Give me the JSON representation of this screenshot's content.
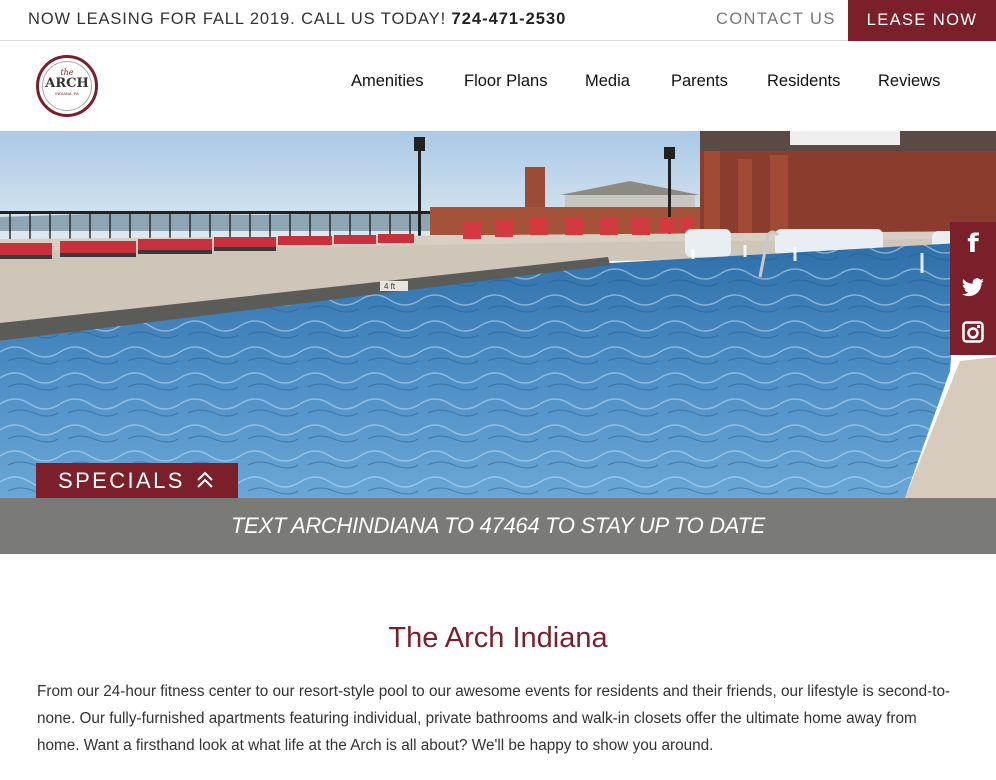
{
  "topbar": {
    "announcement": "NOW LEASING FOR FALL 2019. CALL US TODAY! ",
    "phone": "724-471-2530",
    "contact_label": "CONTACT US",
    "lease_label": "LEASE NOW"
  },
  "logo": {
    "the": "the",
    "name": "ARCH",
    "location": "INDIANA, PA"
  },
  "nav": {
    "items": [
      "Amenities",
      "Floor Plans",
      "Media",
      "Parents",
      "Residents",
      "Reviews"
    ]
  },
  "hero": {
    "depth_marker": "4 ft"
  },
  "social": {
    "icons": [
      "facebook-icon",
      "twitter-icon",
      "instagram-icon"
    ],
    "facebook_glyph": "f"
  },
  "specials": {
    "label": "SPECIALS"
  },
  "promo": {
    "text": "TEXT ARCHINDIANA TO 47464 TO STAY UP TO DATE"
  },
  "main": {
    "title": "The Arch Indiana",
    "intro": "From our 24-hour fitness center to our resort-style pool to our awesome events for residents and their friends, our lifestyle is second-to-none. Our fully-furnished apartments featuring individual, private bathrooms and walk-in closets offer the ultimate home away from home. Want a firsthand look at what life at the Arch is all about? We'll be happy to show you around."
  },
  "colors": {
    "brand": "#7b1f2a",
    "promo_bar": "#7a7a76"
  }
}
